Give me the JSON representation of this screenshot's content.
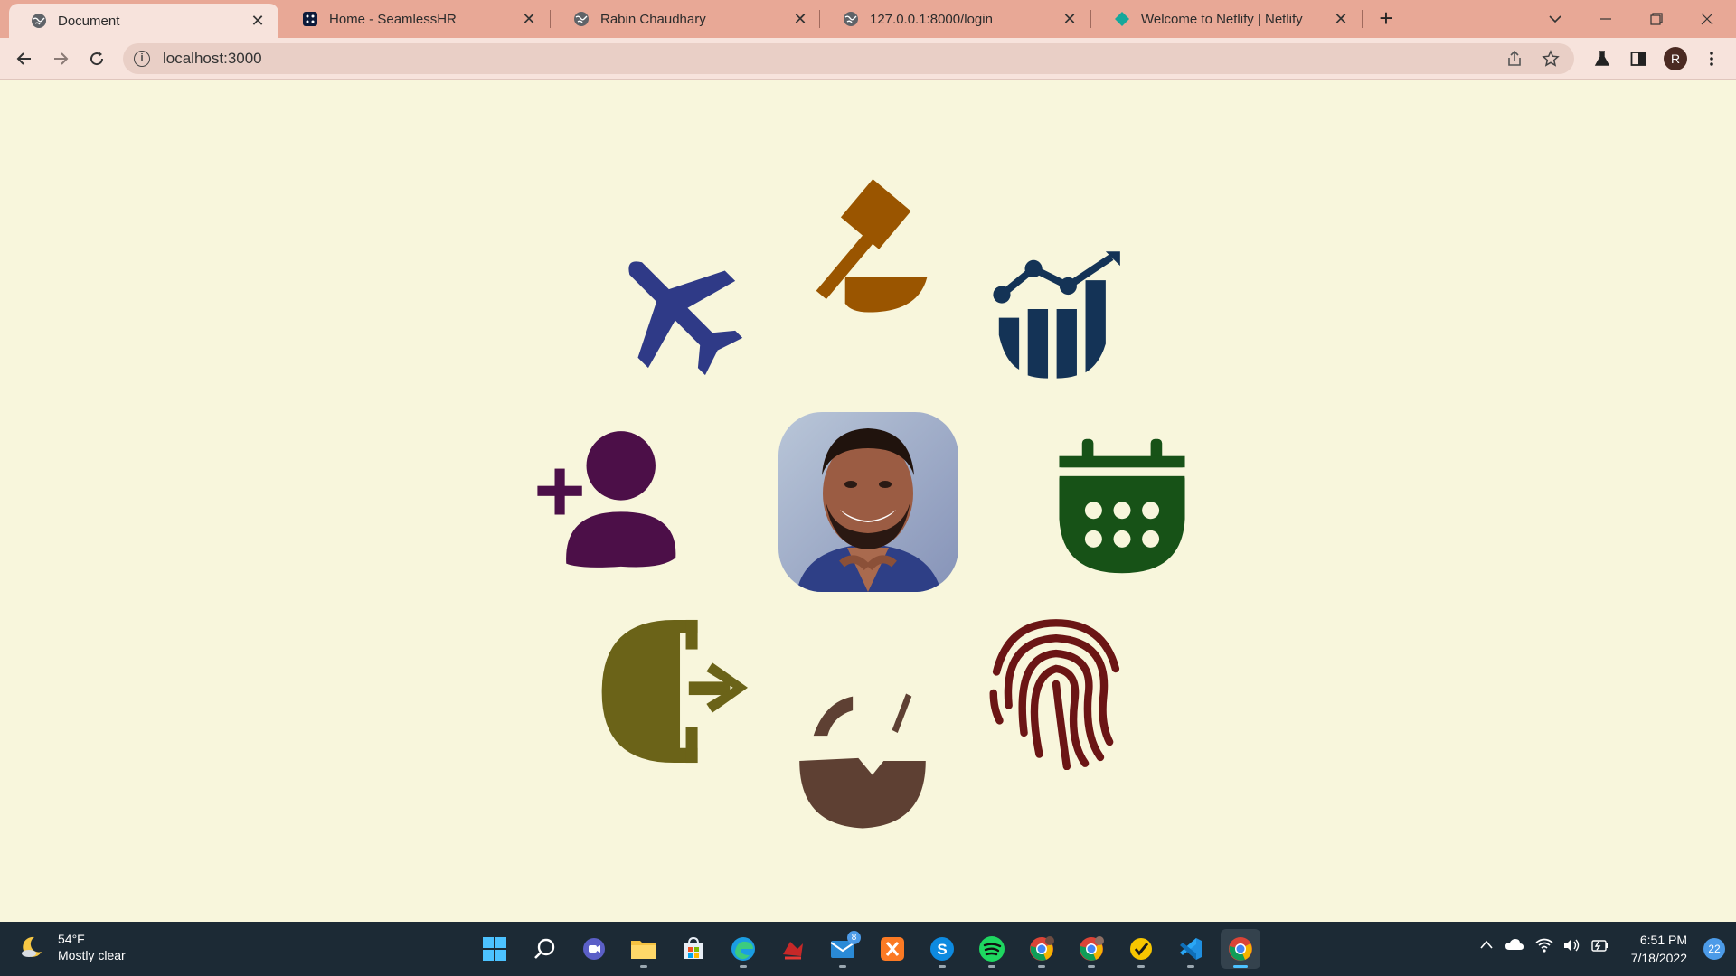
{
  "browser": {
    "tabs": [
      {
        "title": "Document",
        "favicon": "globe-icon",
        "active": true
      },
      {
        "title": "Home - SeamlessHR",
        "favicon": "seamlesshr-icon",
        "active": false
      },
      {
        "title": "Rabin Chaudhary",
        "favicon": "globe-icon",
        "active": false
      },
      {
        "title": "127.0.0.1:8000/login",
        "favicon": "globe-icon",
        "active": false
      },
      {
        "title": "Welcome to Netlify | Netlify",
        "favicon": "netlify-icon",
        "active": false
      }
    ],
    "address": "localhost:3000",
    "profile_initial": "R"
  },
  "page": {
    "icons": [
      {
        "name": "airplane-icon",
        "color": "#2f3a87"
      },
      {
        "name": "gavel-icon",
        "color": "#9a5500"
      },
      {
        "name": "chart-growth-icon",
        "color": "#143356"
      },
      {
        "name": "add-user-icon",
        "color": "#4c0f48"
      },
      {
        "name": "profile-photo"
      },
      {
        "name": "calendar-icon",
        "color": "#175217"
      },
      {
        "name": "logout-icon",
        "color": "#6b6318"
      },
      {
        "name": "coconut-icon",
        "color": "#5e4033"
      },
      {
        "name": "fingerprint-icon",
        "color": "#6b1515"
      }
    ]
  },
  "taskbar": {
    "weather": {
      "temp": "54°F",
      "condition": "Mostly clear"
    },
    "apps": [
      "windows-start-icon",
      "search-icon",
      "teams-chat-icon",
      "file-explorer-icon",
      "microsoft-store-icon",
      "edge-icon",
      "app-red-icon",
      "mail-icon",
      "xampp-icon",
      "skype-icon",
      "spotify-icon",
      "chrome-profile-icon",
      "chrome-profile-icon",
      "norton-icon",
      "vscode-icon",
      "chrome-beta-icon"
    ],
    "mail_badge": "8",
    "time": "6:51 PM",
    "date": "7/18/2022",
    "notifications": "22"
  }
}
